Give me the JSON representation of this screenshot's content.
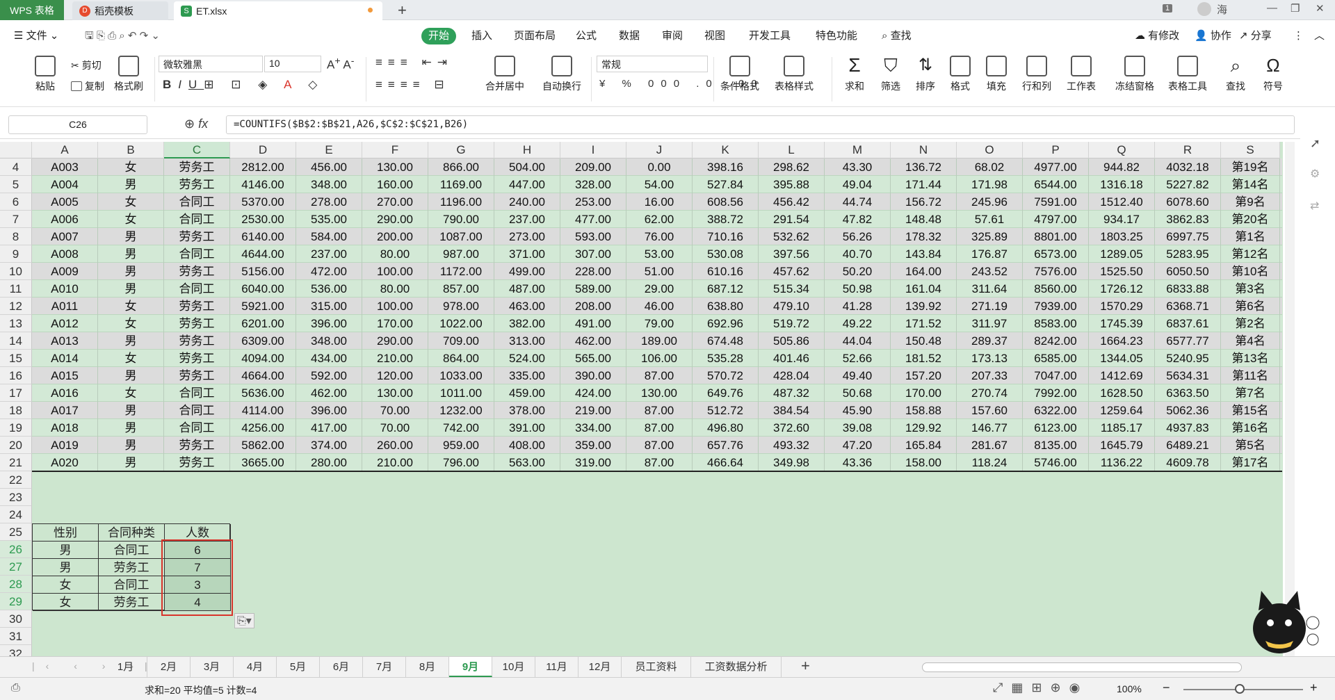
{
  "titlebar": {
    "app_tab": "WPS 表格",
    "tab2": "稻壳模板",
    "tab3": "ET.xlsx",
    "user_badge": "1",
    "user_name": "海"
  },
  "menu": {
    "file": "文件",
    "items": [
      "开始",
      "插入",
      "页面布局",
      "公式",
      "数据",
      "审阅",
      "视图",
      "开发工具",
      "特色功能"
    ],
    "search": "查找",
    "modified": "有修改",
    "collab": "协作",
    "share": "分享"
  },
  "toolbar": {
    "paste": "粘贴",
    "cut": "剪切",
    "copy": "复制",
    "format_painter": "格式刷",
    "font": "微软雅黑",
    "size": "10",
    "number_format": "常规",
    "merge": "合并居中",
    "wrap": "自动换行",
    "cond_format": "条件格式",
    "table_style": "表格样式",
    "sum": "求和",
    "filter": "筛选",
    "sort": "排序",
    "format": "格式",
    "fill": "填充",
    "rowcol": "行和列",
    "worksheet": "工作表",
    "freeze": "冻结窗格",
    "table_tools": "表格工具",
    "find": "查找",
    "symbol": "符号"
  },
  "formula": {
    "cell_ref": "C26",
    "fx": "fx",
    "text": "=COUNTIFS($B$2:$B$21,A26,$C$2:$C$21,B26)"
  },
  "columns": [
    "A",
    "B",
    "C",
    "D",
    "E",
    "F",
    "G",
    "H",
    "I",
    "J",
    "K",
    "L",
    "M",
    "N",
    "O",
    "P",
    "Q",
    "R",
    "S"
  ],
  "rows": [
    {
      "n": "4",
      "c": [
        "A003",
        "女",
        "劳务工",
        "2812.00",
        "456.00",
        "130.00",
        "866.00",
        "504.00",
        "209.00",
        "0.00",
        "398.16",
        "298.62",
        "43.30",
        "136.72",
        "68.02",
        "4977.00",
        "944.82",
        "4032.18",
        "第19名"
      ]
    },
    {
      "n": "5",
      "c": [
        "A004",
        "男",
        "劳务工",
        "4146.00",
        "348.00",
        "160.00",
        "1169.00",
        "447.00",
        "328.00",
        "54.00",
        "527.84",
        "395.88",
        "49.04",
        "171.44",
        "171.98",
        "6544.00",
        "1316.18",
        "5227.82",
        "第14名"
      ]
    },
    {
      "n": "6",
      "c": [
        "A005",
        "女",
        "合同工",
        "5370.00",
        "278.00",
        "270.00",
        "1196.00",
        "240.00",
        "253.00",
        "16.00",
        "608.56",
        "456.42",
        "44.74",
        "156.72",
        "245.96",
        "7591.00",
        "1512.40",
        "6078.60",
        "第9名"
      ]
    },
    {
      "n": "7",
      "c": [
        "A006",
        "女",
        "合同工",
        "2530.00",
        "535.00",
        "290.00",
        "790.00",
        "237.00",
        "477.00",
        "62.00",
        "388.72",
        "291.54",
        "47.82",
        "148.48",
        "57.61",
        "4797.00",
        "934.17",
        "3862.83",
        "第20名"
      ]
    },
    {
      "n": "8",
      "c": [
        "A007",
        "男",
        "劳务工",
        "6140.00",
        "584.00",
        "200.00",
        "1087.00",
        "273.00",
        "593.00",
        "76.00",
        "710.16",
        "532.62",
        "56.26",
        "178.32",
        "325.89",
        "8801.00",
        "1803.25",
        "6997.75",
        "第1名"
      ]
    },
    {
      "n": "9",
      "c": [
        "A008",
        "男",
        "合同工",
        "4644.00",
        "237.00",
        "80.00",
        "987.00",
        "371.00",
        "307.00",
        "53.00",
        "530.08",
        "397.56",
        "40.70",
        "143.84",
        "176.87",
        "6573.00",
        "1289.05",
        "5283.95",
        "第12名"
      ]
    },
    {
      "n": "10",
      "c": [
        "A009",
        "男",
        "劳务工",
        "5156.00",
        "472.00",
        "100.00",
        "1172.00",
        "499.00",
        "228.00",
        "51.00",
        "610.16",
        "457.62",
        "50.20",
        "164.00",
        "243.52",
        "7576.00",
        "1525.50",
        "6050.50",
        "第10名"
      ]
    },
    {
      "n": "11",
      "c": [
        "A010",
        "男",
        "合同工",
        "6040.00",
        "536.00",
        "80.00",
        "857.00",
        "487.00",
        "589.00",
        "29.00",
        "687.12",
        "515.34",
        "50.98",
        "161.04",
        "311.64",
        "8560.00",
        "1726.12",
        "6833.88",
        "第3名"
      ]
    },
    {
      "n": "12",
      "c": [
        "A011",
        "女",
        "劳务工",
        "5921.00",
        "315.00",
        "100.00",
        "978.00",
        "463.00",
        "208.00",
        "46.00",
        "638.80",
        "479.10",
        "41.28",
        "139.92",
        "271.19",
        "7939.00",
        "1570.29",
        "6368.71",
        "第6名"
      ]
    },
    {
      "n": "13",
      "c": [
        "A012",
        "女",
        "劳务工",
        "6201.00",
        "396.00",
        "170.00",
        "1022.00",
        "382.00",
        "491.00",
        "79.00",
        "692.96",
        "519.72",
        "49.22",
        "171.52",
        "311.97",
        "8583.00",
        "1745.39",
        "6837.61",
        "第2名"
      ]
    },
    {
      "n": "14",
      "c": [
        "A013",
        "男",
        "劳务工",
        "6309.00",
        "348.00",
        "290.00",
        "709.00",
        "313.00",
        "462.00",
        "189.00",
        "674.48",
        "505.86",
        "44.04",
        "150.48",
        "289.37",
        "8242.00",
        "1664.23",
        "6577.77",
        "第4名"
      ]
    },
    {
      "n": "15",
      "c": [
        "A014",
        "女",
        "劳务工",
        "4094.00",
        "434.00",
        "210.00",
        "864.00",
        "524.00",
        "565.00",
        "106.00",
        "535.28",
        "401.46",
        "52.66",
        "181.52",
        "173.13",
        "6585.00",
        "1344.05",
        "5240.95",
        "第13名"
      ]
    },
    {
      "n": "16",
      "c": [
        "A015",
        "男",
        "劳务工",
        "4664.00",
        "592.00",
        "120.00",
        "1033.00",
        "335.00",
        "390.00",
        "87.00",
        "570.72",
        "428.04",
        "49.40",
        "157.20",
        "207.33",
        "7047.00",
        "1412.69",
        "5634.31",
        "第11名"
      ]
    },
    {
      "n": "17",
      "c": [
        "A016",
        "女",
        "合同工",
        "5636.00",
        "462.00",
        "130.00",
        "1011.00",
        "459.00",
        "424.00",
        "130.00",
        "649.76",
        "487.32",
        "50.68",
        "170.00",
        "270.74",
        "7992.00",
        "1628.50",
        "6363.50",
        "第7名"
      ]
    },
    {
      "n": "18",
      "c": [
        "A017",
        "男",
        "合同工",
        "4114.00",
        "396.00",
        "70.00",
        "1232.00",
        "378.00",
        "219.00",
        "87.00",
        "512.72",
        "384.54",
        "45.90",
        "158.88",
        "157.60",
        "6322.00",
        "1259.64",
        "5062.36",
        "第15名"
      ]
    },
    {
      "n": "19",
      "c": [
        "A018",
        "男",
        "合同工",
        "4256.00",
        "417.00",
        "70.00",
        "742.00",
        "391.00",
        "334.00",
        "87.00",
        "496.80",
        "372.60",
        "39.08",
        "129.92",
        "146.77",
        "6123.00",
        "1185.17",
        "4937.83",
        "第16名"
      ]
    },
    {
      "n": "20",
      "c": [
        "A019",
        "男",
        "劳务工",
        "5862.00",
        "374.00",
        "260.00",
        "959.00",
        "408.00",
        "359.00",
        "87.00",
        "657.76",
        "493.32",
        "47.20",
        "165.84",
        "281.67",
        "8135.00",
        "1645.79",
        "6489.21",
        "第5名"
      ]
    },
    {
      "n": "21",
      "c": [
        "A020",
        "男",
        "劳务工",
        "3665.00",
        "280.00",
        "210.00",
        "796.00",
        "563.00",
        "319.00",
        "87.00",
        "466.64",
        "349.98",
        "43.36",
        "158.00",
        "118.24",
        "5746.00",
        "1136.22",
        "4609.78",
        "第17名"
      ]
    }
  ],
  "empty_rows": [
    "22",
    "23",
    "24"
  ],
  "summary": {
    "header_row": "25",
    "headers": [
      "性别",
      "合同种类",
      "人数"
    ],
    "rows": [
      {
        "n": "26",
        "c": [
          "男",
          "合同工",
          "6"
        ]
      },
      {
        "n": "27",
        "c": [
          "男",
          "劳务工",
          "7"
        ]
      },
      {
        "n": "28",
        "c": [
          "女",
          "合同工",
          "3"
        ]
      },
      {
        "n": "29",
        "c": [
          "女",
          "劳务工",
          "4"
        ]
      }
    ]
  },
  "trailing_rows": [
    "30",
    "31",
    "32"
  ],
  "sheets": [
    "1月",
    "2月",
    "3月",
    "4月",
    "5月",
    "6月",
    "7月",
    "8月",
    "9月",
    "10月",
    "11月",
    "12月",
    "员工资料",
    "工资数据分析"
  ],
  "active_sheet": "9月",
  "status": {
    "text": "求和=20  平均值=5  计数=4",
    "zoom": "100%"
  },
  "colors": {
    "accent": "#2d9a50",
    "selection": "#d9342b",
    "grid_bg": "#cde6cf"
  }
}
